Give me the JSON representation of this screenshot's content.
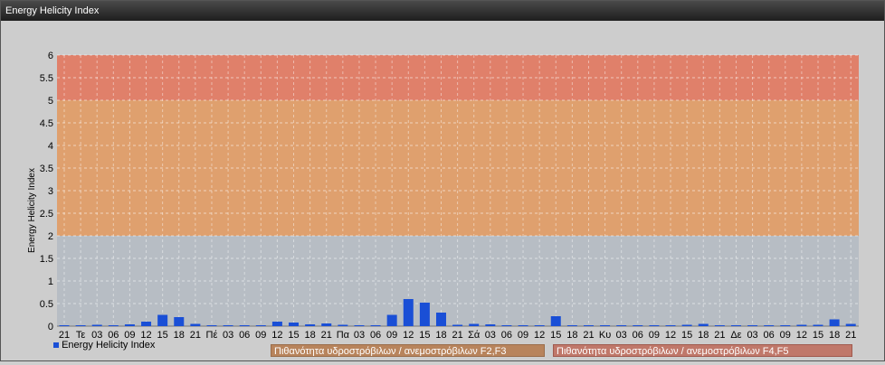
{
  "window": {
    "title": "Energy Helicity Index"
  },
  "chart_data": {
    "type": "bar",
    "ylabel": "Energy Helicity Index",
    "ylim": [
      0,
      6
    ],
    "yticks": [
      0,
      0.5,
      1,
      1.5,
      2,
      2.5,
      3,
      3.5,
      4,
      4.5,
      5,
      5.5,
      6
    ],
    "categories": [
      "21",
      "Τε",
      "03",
      "06",
      "09",
      "12",
      "15",
      "18",
      "21",
      "Πέ",
      "03",
      "06",
      "09",
      "12",
      "15",
      "18",
      "21",
      "Πα",
      "03",
      "06",
      "09",
      "12",
      "15",
      "18",
      "21",
      "Σά",
      "03",
      "06",
      "09",
      "12",
      "15",
      "18",
      "21",
      "Κυ",
      "03",
      "06",
      "09",
      "12",
      "15",
      "18",
      "21",
      "Δε",
      "03",
      "06",
      "09",
      "12",
      "15",
      "18",
      "21"
    ],
    "series": [
      {
        "name": "Energy Helicity Index",
        "color": "#1a4fd6",
        "values": [
          0.02,
          0.02,
          0.03,
          0.02,
          0.04,
          0.1,
          0.25,
          0.2,
          0.05,
          0.02,
          0.02,
          0.02,
          0.02,
          0.1,
          0.08,
          0.04,
          0.06,
          0.03,
          0.02,
          0.02,
          0.25,
          0.6,
          0.52,
          0.3,
          0.03,
          0.05,
          0.04,
          0.02,
          0.02,
          0.02,
          0.22,
          0.02,
          0.02,
          0.02,
          0.02,
          0.02,
          0.02,
          0.02,
          0.03,
          0.05,
          0.02,
          0.02,
          0.02,
          0.02,
          0.02,
          0.03,
          0.03,
          0.15,
          0.05
        ]
      }
    ],
    "bands": [
      {
        "from": 0,
        "to": 2,
        "color": "#b7bdc4"
      },
      {
        "from": 2,
        "to": 5,
        "color": "#dfa06e"
      },
      {
        "from": 5,
        "to": 6,
        "color": "#e0806a"
      }
    ],
    "grid": true,
    "legend": {
      "series_label": "Energy Helicity Index",
      "band1_label": "Πιθανότητα υδροστρόβιλων / ανεμοστρόβιλων F2,F3",
      "band1_color": "#b8845c",
      "band2_label": "Πιθανότητα υδροστρόβιλων / ανεμοστρόβιλων F4,F5",
      "band2_color": "#c0786a"
    }
  }
}
